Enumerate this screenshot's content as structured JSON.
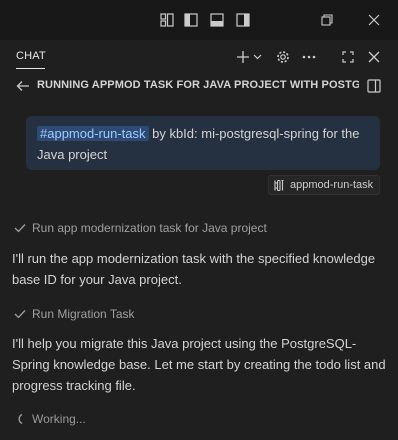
{
  "header": {
    "tab_label": "CHAT"
  },
  "session": {
    "title": "RUNNING APPMOD TASK FOR JAVA PROJECT WITH POSTGR..."
  },
  "user_message": {
    "tag": "#appmod-run-task",
    "text": " by kbId: mi-postgresql-spring for the Java project"
  },
  "reference_chip": {
    "label": "appmod-run-task",
    "icon": "tools-icon"
  },
  "steps": [
    {
      "label": "Run app modernization task for Java project",
      "icon": "check-icon"
    },
    {
      "label": "Run Migration Task",
      "icon": "check-icon"
    }
  ],
  "responses": [
    "I'll run the app modernization task with the specified knowledge base ID for your Java project.",
    "I'll help you migrate this Java project using the PostgreSQL-Spring knowledge base. Let me start by creating the todo list and progress tracking file."
  ],
  "status": {
    "working_text": "Working..."
  },
  "colors": {
    "background": "#1f1f1f",
    "titlebar": "#181818",
    "bubble": "#253040",
    "tag_fg": "#9ecbff",
    "tag_bg": "#2c4a73"
  }
}
